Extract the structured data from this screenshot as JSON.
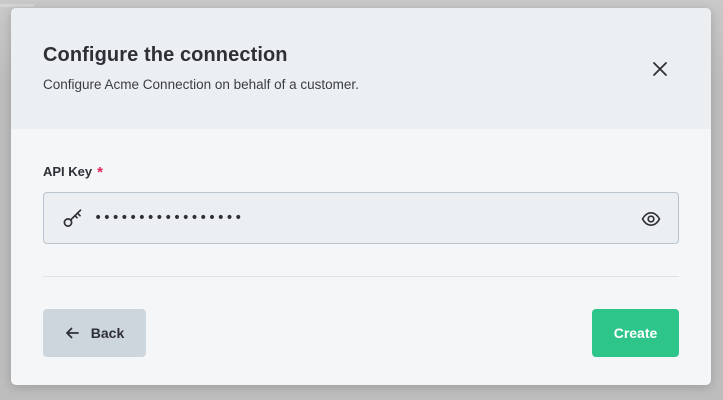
{
  "modal": {
    "title": "Configure the connection",
    "subtitle": "Configure Acme Connection on behalf of a customer.",
    "close_icon": "close-icon"
  },
  "field": {
    "label": "API Key",
    "required_mark": "*",
    "value": "•••••••••••••••••",
    "leading_icon": "key-icon",
    "trailing_icon": "eye-icon"
  },
  "footer": {
    "back_label": "Back",
    "back_icon": "arrow-left-icon",
    "create_label": "Create"
  },
  "colors": {
    "primary": "#2ec58a",
    "required": "#e0245e",
    "secondary_button": "#cdd5dd",
    "header_bg": "#eceff2"
  }
}
